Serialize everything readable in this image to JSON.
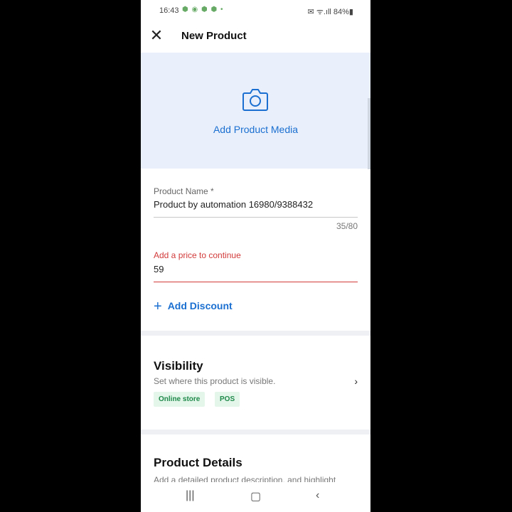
{
  "status": {
    "time": "16:43",
    "notifications": "⬢ ◉ ⬢ ⬢ •",
    "right": "✉ ᯤ.ıll 84%▮"
  },
  "header": {
    "title": "New Product"
  },
  "media": {
    "label": "Add Product Media",
    "icon": "camera-icon"
  },
  "product_name": {
    "label": "Product Name *",
    "value": "Product by automation 16980/9388432",
    "counter": "35/80"
  },
  "price": {
    "error_label": "Add a price to continue",
    "value": "59"
  },
  "add_discount": {
    "label": "Add Discount"
  },
  "visibility": {
    "title": "Visibility",
    "subtitle": "Set where this product is visible.",
    "tags": [
      "Online store",
      "POS"
    ]
  },
  "product_details": {
    "title": "Product Details",
    "subtitle": "Add a detailed product description, and highlight"
  },
  "colors": {
    "accent": "#1a6fd0",
    "error": "#d23a3a",
    "tag_bg": "#e4f5ea",
    "tag_fg": "#1f8a4a"
  }
}
